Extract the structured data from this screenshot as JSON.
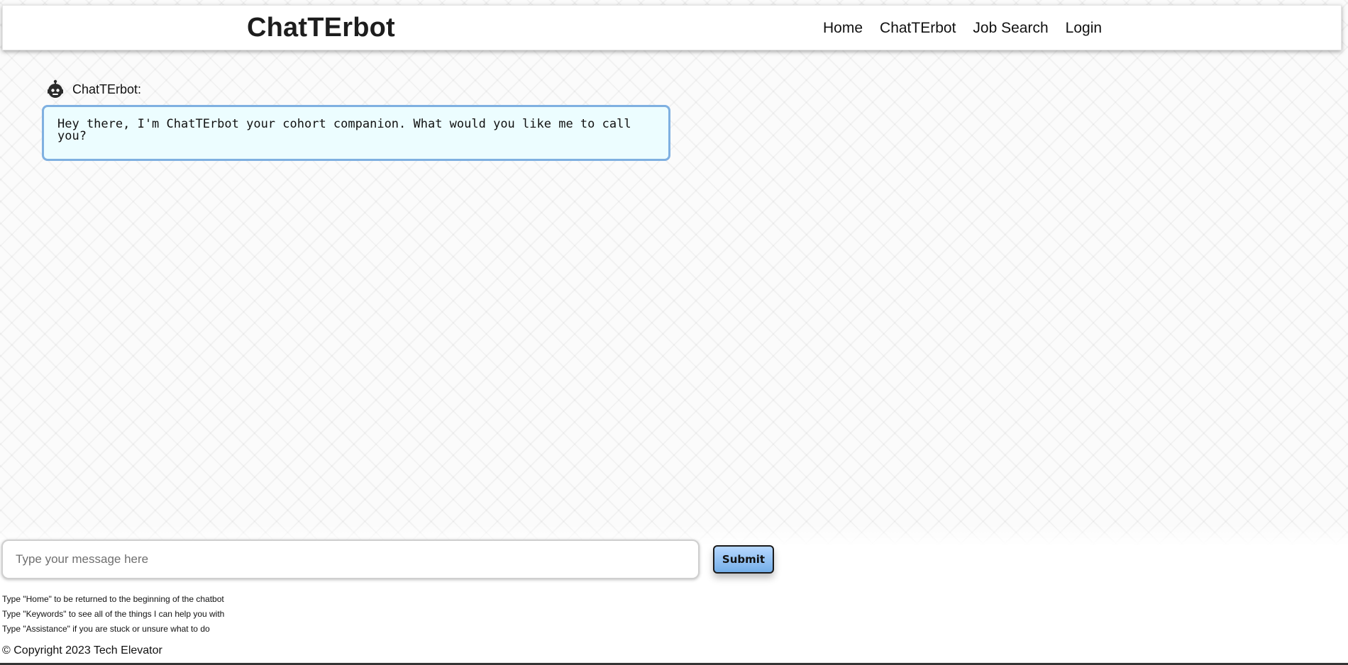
{
  "header": {
    "brand": "ChatTErbot",
    "nav": {
      "home": "Home",
      "chatterbot": "ChatTErbot",
      "job_search": "Job Search",
      "login": "Login"
    }
  },
  "chat": {
    "bot_name": "ChatTErbot:",
    "messages": [
      {
        "text": "Hey there, I'm ChatTErbot your cohort companion. What would you like me to call you?"
      }
    ]
  },
  "input": {
    "placeholder": "Type your message here",
    "value": "",
    "submit_label": "Submit"
  },
  "help": {
    "lines": [
      "Type \"Home\" to be returned to the beginning of the chatbot",
      "Type \"Keywords\" to see all of the things I can help you with",
      "Type \"Assistance\" if you are stuck or unsure what to do"
    ]
  },
  "footer": {
    "copyright": "© Copyright 2023 Tech Elevator"
  },
  "icons": {
    "bot_avatar": "robot-icon"
  },
  "colors": {
    "bubble_bg": "#ecfdff",
    "bubble_border": "#7fb0e1",
    "submit_top": "#b7d8ff",
    "submit_bottom": "#74aee8"
  }
}
